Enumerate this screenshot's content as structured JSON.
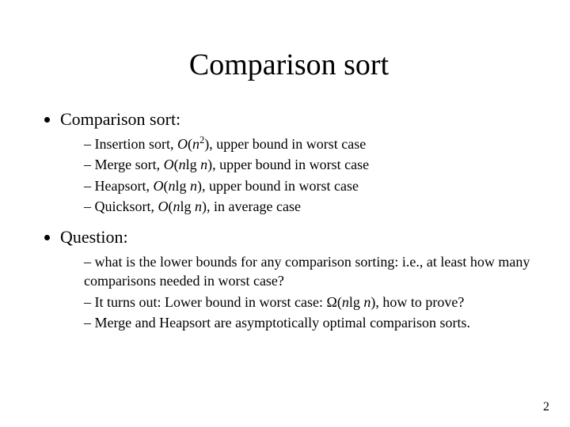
{
  "title": "Comparison sort",
  "bullets": {
    "b1": "Comparison sort:",
    "b2": "Question:"
  },
  "algs": {
    "insertion": {
      "lead": "Insertion sort, ",
      "O": "O",
      "open": "(",
      "n": "n",
      "exp": "2",
      "close": "), upper bound in worst case"
    },
    "merge": {
      "lead": "Merge sort, ",
      "O": "O",
      "open": "(",
      "nlg": "n",
      "mid": "lg ",
      "n2": "n",
      "close": "), upper bound in worst case"
    },
    "heap": {
      "lead": "Heapsort, ",
      "O": "O",
      "open": "(",
      "nlg": "n",
      "mid": "lg ",
      "n2": "n",
      "close": "), upper bound in worst case"
    },
    "quick": {
      "lead": "Quicksort, ",
      "O": "O",
      "open": "(",
      "nlg": "n",
      "mid": "lg ",
      "n2": "n",
      "close": "), in average case"
    }
  },
  "q": {
    "q1": "what is the lower bounds for any comparison sorting: i.e., at least how many comparisons needed in worst case?",
    "q2a": "It turns out: Lower bound in worst case: ",
    "omega": "Ω",
    "q2open": "(",
    "q2n1": "n",
    "q2mid": "lg ",
    "q2n2": "n",
    "q2b": "), how to prove?",
    "q3": "Merge and Heapsort are asymptotically optimal comparison sorts."
  },
  "page": "2"
}
